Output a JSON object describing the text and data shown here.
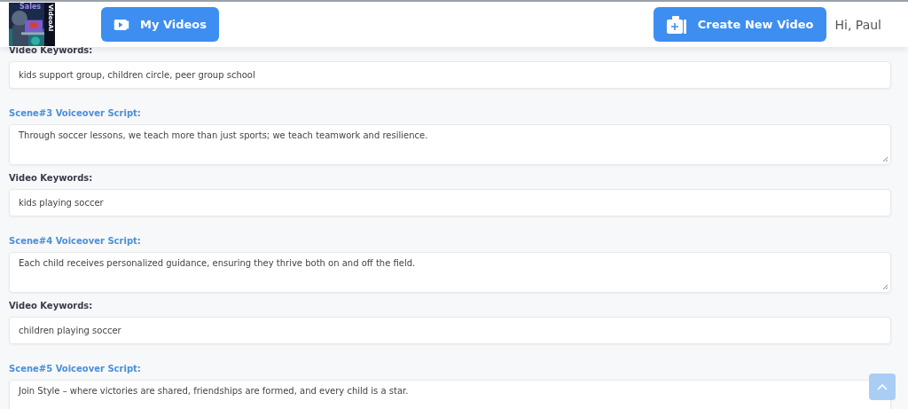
{
  "header": {
    "logo": {
      "title": "Sales",
      "side_text": "VideoAI"
    },
    "my_videos_button": "My Videos",
    "create_button": "Create New Video",
    "greeting": "Hi, Paul"
  },
  "fields": [
    {
      "kind": "keywords",
      "label": "Video Keywords:",
      "value": "kids support group, children circle, peer group school"
    },
    {
      "kind": "script",
      "label": "Scene#3 Voiceover Script:",
      "value": "Through soccer lessons, we teach more than just sports; we teach teamwork and resilience."
    },
    {
      "kind": "keywords",
      "label": "Video Keywords:",
      "value": "kids playing soccer"
    },
    {
      "kind": "script",
      "label": "Scene#4 Voiceover Script:",
      "value": "Each child receives personalized guidance, ensuring they thrive both on and off the field."
    },
    {
      "kind": "keywords",
      "label": "Video Keywords:",
      "value": "children playing soccer"
    },
    {
      "kind": "script",
      "label": "Scene#5 Voiceover Script:",
      "value": "Join Style – where victories are shared, friendships are formed, and every child is a star."
    }
  ]
}
